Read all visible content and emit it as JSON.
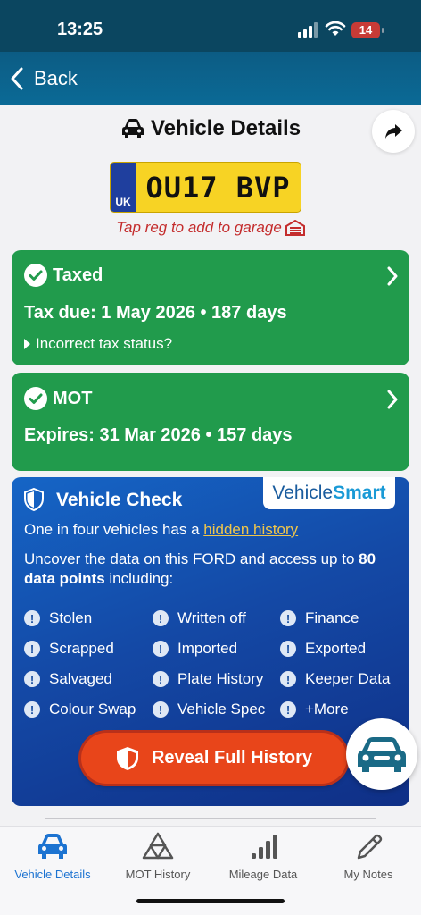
{
  "status_bar": {
    "time": "13:25",
    "battery": "14"
  },
  "nav": {
    "back_label": "Back"
  },
  "header": {
    "title": "Vehicle Details"
  },
  "plate": {
    "country": "UK",
    "registration": "OU17 BVP",
    "tap_hint": "Tap reg to add to garage"
  },
  "tax_card": {
    "status": "Taxed",
    "due_line": "Tax due: 1 May 2026 • 187 days",
    "incorrect_link": "Incorrect tax status?"
  },
  "mot_card": {
    "status": "MOT",
    "expires_line": "Expires: 31 Mar 2026 • 157 days"
  },
  "vehicle_check": {
    "title": "Vehicle Check",
    "brand_part1": "Vehicle",
    "brand_part2": "Smart",
    "line1_prefix": "One in four vehicles has a ",
    "line1_link": "hidden history",
    "line2_prefix": "Uncover the data on this FORD and access up to ",
    "line2_count": "80",
    "line2_bold": "data points",
    "line2_suffix": " including:",
    "features": [
      "Stolen",
      "Written off",
      "Finance",
      "Scrapped",
      "Imported",
      "Exported",
      "Salvaged",
      "Plate History",
      "Keeper Data",
      "Colour Swap",
      "Vehicle Spec",
      "+More"
    ],
    "cta_label": "Reveal Full History"
  },
  "tabs": [
    {
      "label": "Vehicle Details",
      "active": true
    },
    {
      "label": "MOT History"
    },
    {
      "label": "Mileage Data"
    },
    {
      "label": "My Notes"
    }
  ],
  "colors": {
    "nav": "#0b6a96",
    "green_card": "#219b4c",
    "check_blue": "#1449a6",
    "cta_orange": "#e8451a",
    "plate_yellow": "#f7d324",
    "active_tab": "#1c73d1",
    "warning_red": "#c42d2d"
  }
}
